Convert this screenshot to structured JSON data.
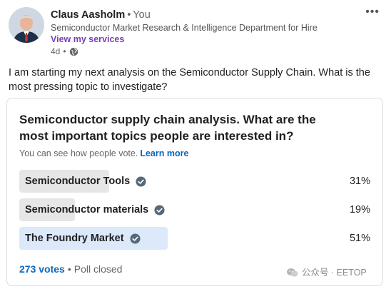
{
  "post": {
    "author_name": "Claus Aasholm",
    "separator": "•",
    "author_relation": "You",
    "headline": "Semiconductor Market Research & Intelligence Department for Hire",
    "services_link": "View my services",
    "time_ago": "4d",
    "meta_separator": "•",
    "visibility_icon": "globe-icon",
    "text": "I am starting my next analysis on the Semiconductor Supply Chain. What is the most pressing topic to investigate?"
  },
  "poll": {
    "question": "Semiconductor supply chain analysis. What are the most important topics people are interested in?",
    "note": "You can see how people vote.",
    "learn_more": "Learn more",
    "options": [
      {
        "label": "Semiconductor Tools",
        "percent_text": "31%",
        "share": 0.31,
        "winner": false
      },
      {
        "label": "Semiconductor materials",
        "percent_text": "19%",
        "share": 0.19,
        "winner": false
      },
      {
        "label": "The Foundry Market",
        "percent_text": "51%",
        "share": 0.51,
        "winner": true
      }
    ],
    "votes": "273 votes",
    "footer_separator": "•",
    "status": "Poll closed"
  },
  "watermark": {
    "text": "公众号 · EETOP",
    "icon": "wechat-icon"
  },
  "colors": {
    "link_blue": "#0a66c2",
    "services_purple": "#7a3fb4",
    "bar_gray": "#e6e6e6",
    "bar_winner": "#dbe9fb",
    "check_gray": "#56687a"
  }
}
